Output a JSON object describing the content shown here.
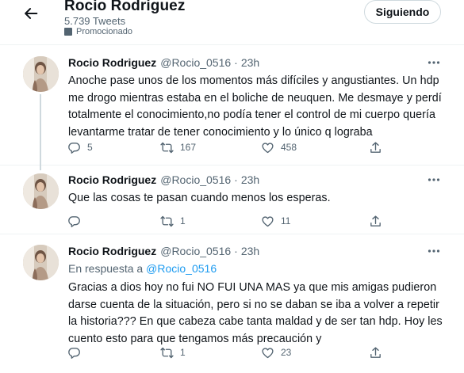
{
  "header": {
    "name": "Rocio Rodriguez",
    "tweet_count": "5.739 Tweets",
    "promo_label": "Promocionado",
    "follow_label": "Siguiendo"
  },
  "tweets": [
    {
      "name": "Rocio Rodriguez",
      "handle": "@Rocio_0516",
      "dot": "·",
      "time": "23h",
      "text": "Anoche pase unos de los momentos más difíciles y angustiantes. Un hdp me drogo mientras estaba en el boliche de neuquen. Me desmaye y perdí totalmente el conocimiento,no podía tener el control de mi cuerpo quería levantarme tratar de tener conocimiento y lo único q lograba",
      "replies": "5",
      "retweets": "167",
      "likes": "458"
    },
    {
      "name": "Rocio Rodriguez",
      "handle": "@Rocio_0516",
      "dot": "·",
      "time": "23h",
      "text": "Que las cosas te pasan cuando menos los esperas.",
      "replies": "",
      "retweets": "1",
      "likes": "11"
    },
    {
      "name": "Rocio Rodriguez",
      "handle": "@Rocio_0516",
      "dot": "·",
      "time": "23h",
      "reply_prefix": "En respuesta a",
      "reply_handle": "@Rocio_0516",
      "text": "Gracias a dios hoy no fui NO FUI UNA MAS ya que mis amigas pudieron darse cuenta de la situación, pero si no se daban se iba a volver a repetir la historia??? En que cabeza cabe tanta maldad y de ser tan hdp. Hoy les cuento esto para que tengamos más precaución y",
      "replies": "",
      "retweets": "1",
      "likes": "23"
    }
  ],
  "colors": {
    "accent": "#1d9bf0",
    "text": "#0f1419",
    "secondary": "#536471",
    "divider": "#eff3f4"
  },
  "icons": [
    "back-arrow-icon",
    "promoted-icon",
    "more-icon",
    "reply-icon",
    "retweet-icon",
    "like-icon",
    "share-icon"
  ]
}
